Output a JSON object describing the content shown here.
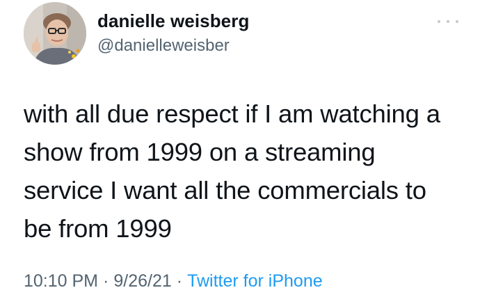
{
  "tweet": {
    "author": {
      "display_name": "danielle weisberg",
      "handle": "@danielleweisber"
    },
    "more_icon": "ellipsis-icon",
    "text_lines": [
      "with all due respect if I am watching a",
      "show from 1999 on a streaming",
      "service I want all the commercials to",
      "be from 1999"
    ],
    "meta": {
      "time": "10:10 PM",
      "date": "9/26/21",
      "separator": "·",
      "source": "Twitter for iPhone"
    }
  },
  "colors": {
    "text": "#0f1419",
    "secondary": "#536471",
    "link": "#1d9bf0"
  }
}
